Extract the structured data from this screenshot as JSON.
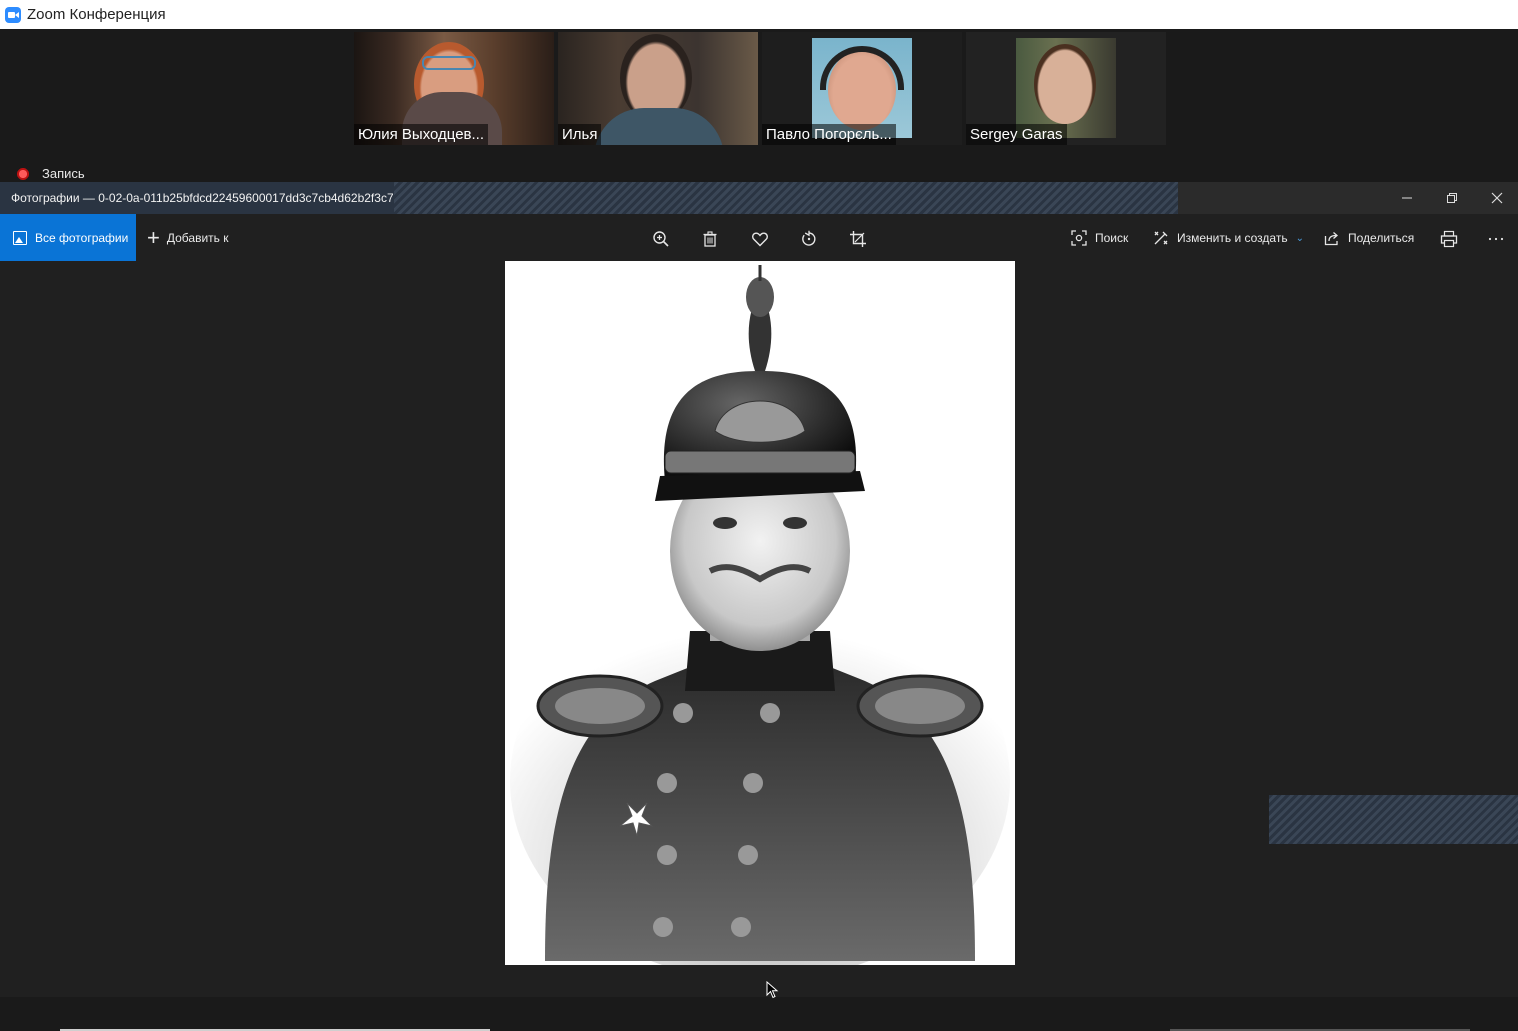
{
  "zoom": {
    "window_title": "Zoom Конференция",
    "recording_label": "Запись",
    "participants": [
      {
        "name": "Юлия Выходцев..."
      },
      {
        "name": "Илья"
      },
      {
        "name": "Павло Погорєль..."
      },
      {
        "name": "Sergey Garas"
      }
    ]
  },
  "photos": {
    "window_title": "Фотографии — 0-02-0a-011b25bfdcd22459600017dd3c7cb4d62b2f3c7(",
    "all_photos_label": "Все фотографии",
    "add_to_label": "Добавить к",
    "search_label": "Поиск",
    "edit_create_label": "Изменить и создать",
    "share_label": "Поделиться"
  },
  "colors": {
    "accent": "#0a74d6",
    "active_speaker": "#8ab53a",
    "recording": "#e53935"
  },
  "icons": [
    "zoom-logo-icon",
    "record-icon",
    "photo-icon",
    "plus-icon",
    "zoom-in-icon",
    "trash-icon",
    "heart-icon",
    "rotate-icon",
    "crop-icon",
    "search-icon",
    "edit-create-icon",
    "share-icon",
    "print-icon",
    "more-icon",
    "minimize-icon",
    "restore-icon",
    "close-icon"
  ]
}
